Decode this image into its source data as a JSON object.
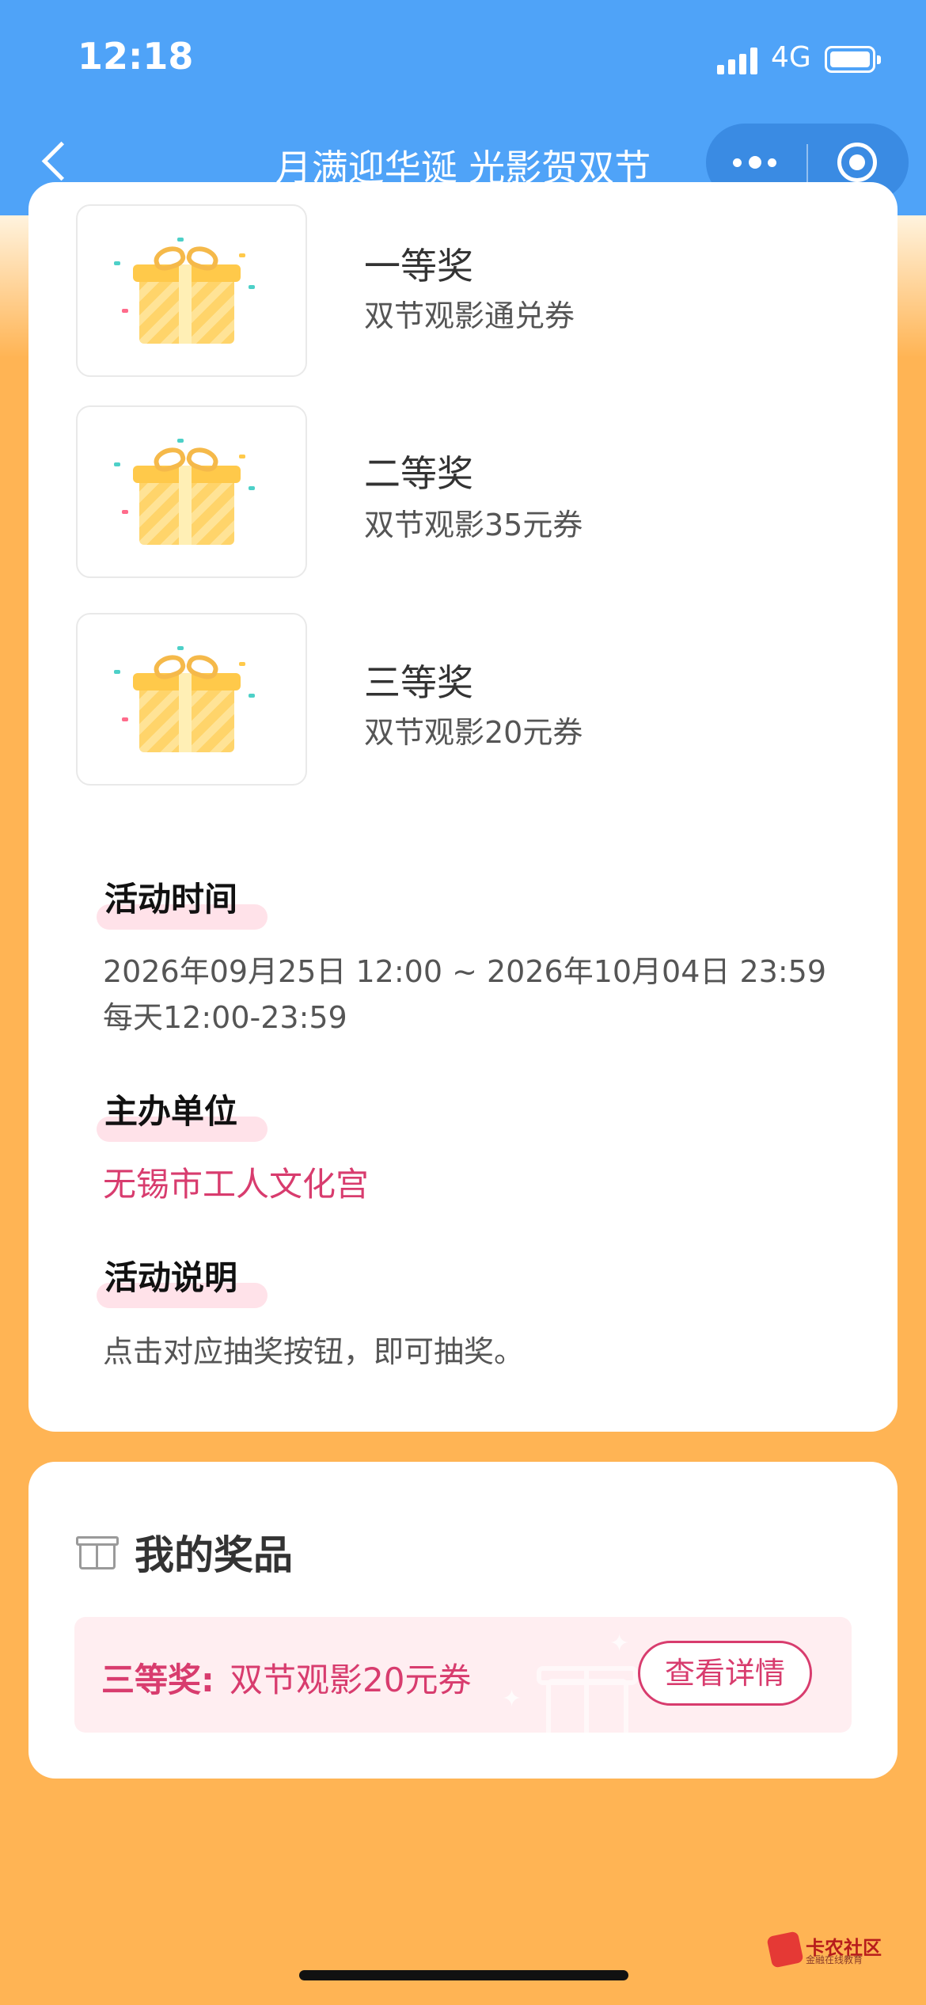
{
  "status_bar": {
    "time": "12:18",
    "network": "4G"
  },
  "nav": {
    "title": "月满迎华诞 光影贺双节"
  },
  "prizes": [
    {
      "level": "一等奖",
      "name": "双节观影通兑券"
    },
    {
      "level": "二等奖",
      "name": "双节观影35元券"
    },
    {
      "level": "三等奖",
      "name": "双节观影20元券"
    }
  ],
  "activity_time": {
    "title": "活动时间",
    "line1": "2026年09月25日 12:00 ~ 2026年10月04日 23:59",
    "line2": "每天12:00-23:59"
  },
  "organizer": {
    "title": "主办单位",
    "name": "无锡市工人文化宫"
  },
  "description": {
    "title": "活动说明",
    "text": "点击对应抽奖按钮，即可抽奖。"
  },
  "my_prizes": {
    "title": "我的奖品",
    "item": {
      "level": "三等奖:",
      "name": "双节观影20元券",
      "button": "查看详情"
    }
  },
  "watermark": {
    "text": "卡农社区",
    "subtext": "金融在线教育"
  },
  "colors": {
    "nav_blue": "#4FA3F8",
    "background_orange": "#FFB454",
    "accent_pink": "#D83C6E"
  }
}
